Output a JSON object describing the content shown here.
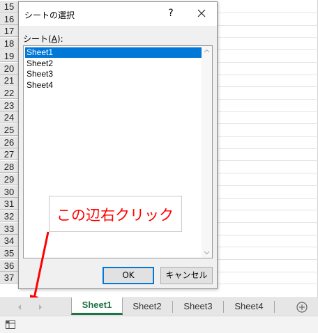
{
  "spreadsheet": {
    "row_numbers": [
      "15",
      "16",
      "17",
      "18",
      "19",
      "20",
      "21",
      "22",
      "23",
      "24",
      "25",
      "26",
      "27",
      "28",
      "29",
      "30",
      "31",
      "32",
      "33",
      "34",
      "35",
      "36",
      "37"
    ]
  },
  "dialog": {
    "title": "シートの選択",
    "help_label": "?",
    "close_icon": "close-icon",
    "list_label_prefix": "シート(",
    "list_label_accel": "A",
    "list_label_suffix": "):",
    "sheets": [
      "Sheet1",
      "Sheet2",
      "Sheet3",
      "Sheet4"
    ],
    "selected_index": 0,
    "ok_label": "OK",
    "cancel_label": "キャンセル",
    "accent_color": "#0078d7"
  },
  "callout": {
    "text": "この辺右クリック",
    "color": "#ff0000"
  },
  "tab_bar": {
    "tabs": [
      "Sheet1",
      "Sheet2",
      "Sheet3",
      "Sheet4"
    ],
    "active_index": 0,
    "active_color": "#217346",
    "prev_icon": "chevron-left-icon",
    "next_icon": "chevron-right-icon",
    "add_icon": "plus-circle-icon"
  },
  "status_bar": {
    "icon": "sheet-status-icon"
  }
}
